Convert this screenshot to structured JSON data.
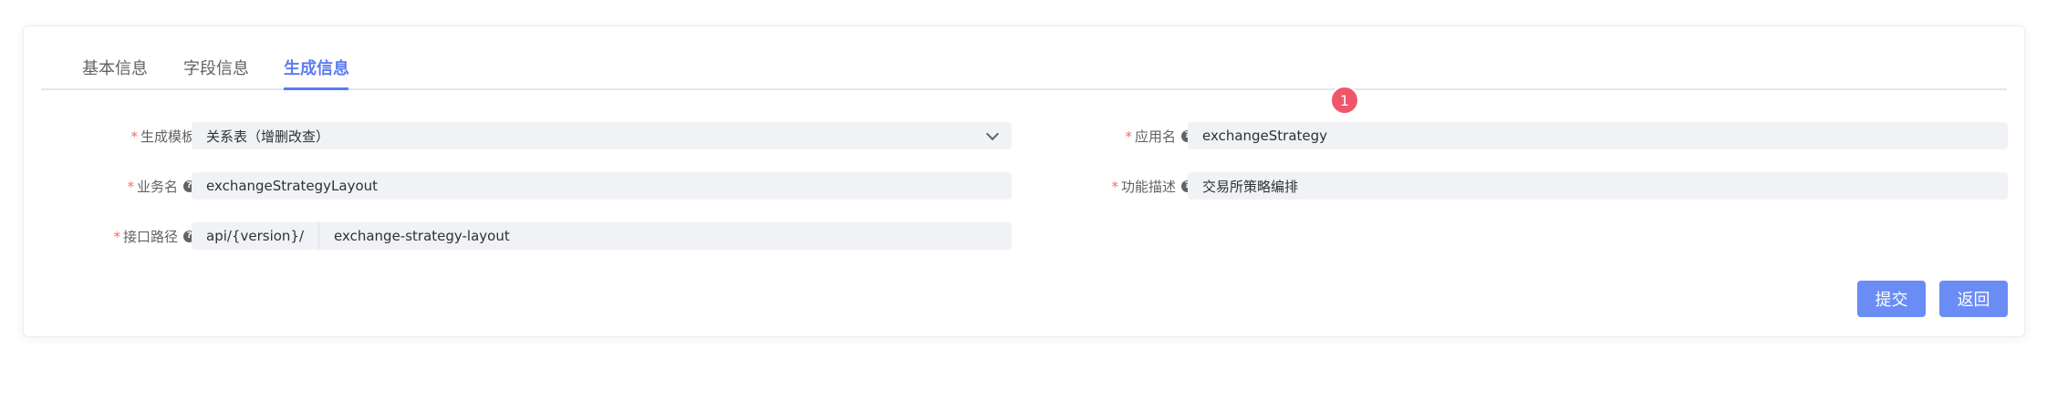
{
  "tabs": [
    {
      "label": "基本信息",
      "active": false
    },
    {
      "label": "字段信息",
      "active": false
    },
    {
      "label": "生成信息",
      "active": true
    }
  ],
  "form": {
    "template": {
      "label": "生成模板",
      "value": "关系表（增删改查）"
    },
    "app_name": {
      "label": "应用名",
      "value": "exchangeStrategy"
    },
    "business_name": {
      "label": "业务名",
      "value": "exchangeStrategyLayout"
    },
    "function_desc": {
      "label": "功能描述",
      "value": "交易所策略编排"
    },
    "api_path": {
      "label": "接口路径",
      "prefix": "api/{version}/",
      "value": "exchange-strategy-layout"
    }
  },
  "badge": {
    "count": "1"
  },
  "actions": {
    "submit_label": "提交",
    "back_label": "返回"
  },
  "colors": {
    "accent": "#5b7cf2",
    "button": "#6a8cf5",
    "required": "#f56c6c",
    "badge": "#f0566a"
  },
  "icons": {
    "help": "question-circle-icon",
    "select": "chevron-down-icon"
  }
}
